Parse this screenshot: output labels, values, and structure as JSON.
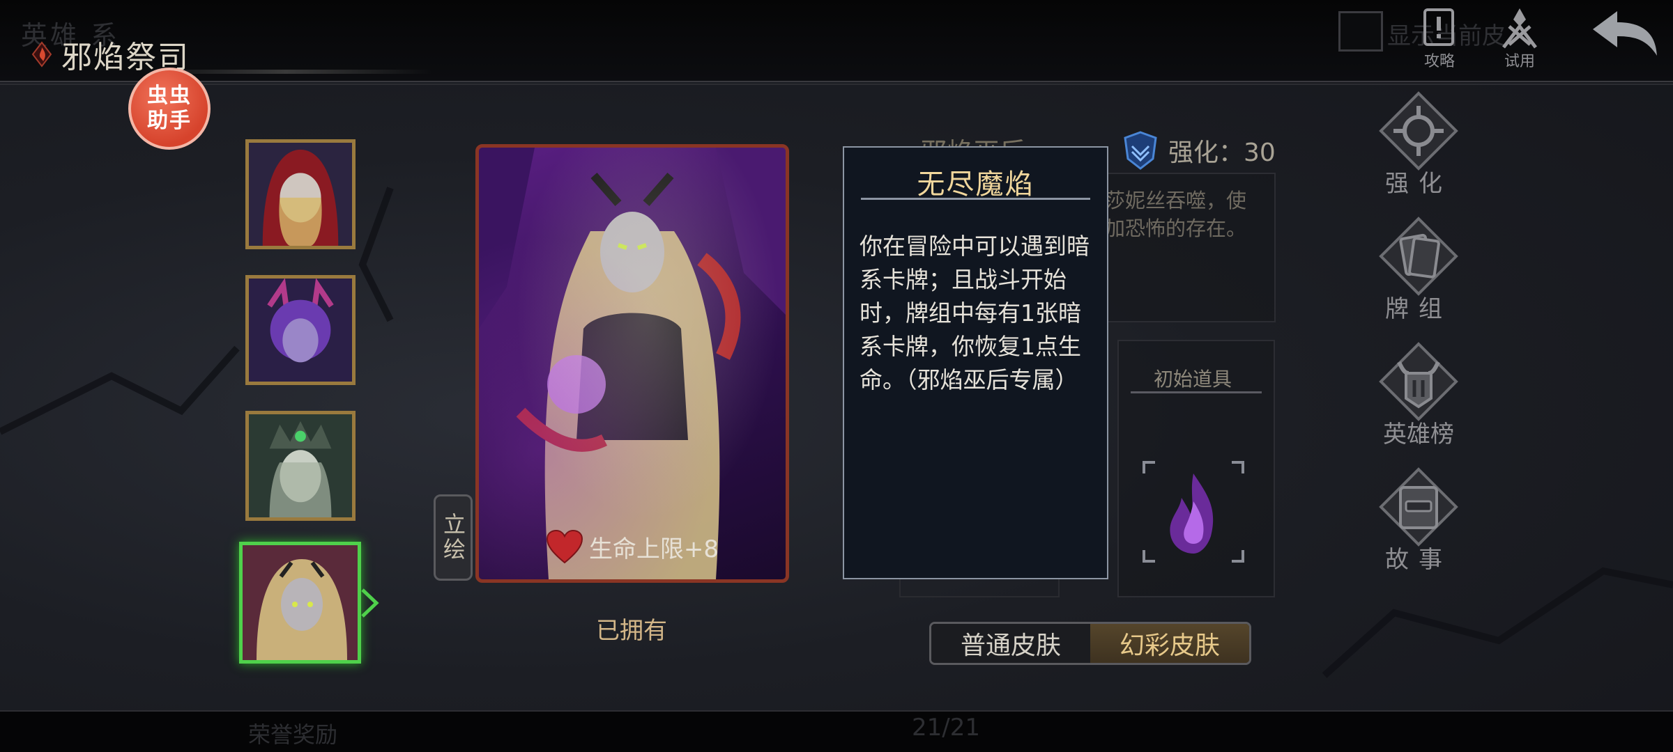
{
  "header": {
    "tabs_ghost": "英雄  系",
    "title": "邪焰祭司",
    "show_checkbox_label": "显示当前皮",
    "strategy_label": "攻略",
    "trial_label": "试用"
  },
  "assistant_badge": "虫虫\n助手",
  "hero_list": [
    {
      "name": "red-hood-hero"
    },
    {
      "name": "purple-horn-hero"
    },
    {
      "name": "green-crown-hero"
    },
    {
      "name": "flame-priestess-hero",
      "selected": true
    }
  ],
  "card": {
    "hp_bonus": "生命上限+8",
    "owned": "已拥有",
    "illustration_button": "立绘"
  },
  "info": {
    "hero_name": "邪焰巫后",
    "enhance": "强化：30",
    "description": "莎妮丝吞噬，使\n加恐怖的存在。",
    "starting_item_label": "初始道具"
  },
  "tooltip": {
    "title": "无尽魔焰",
    "body": "你在冒险中可以遇到暗系卡牌；且战斗开始时，牌组中每有1张暗系卡牌，你恢复1点生命。（邪焰巫后专属）"
  },
  "skin_toggle": {
    "normal": "普通皮肤",
    "illusion": "幻彩皮肤",
    "active": "illusion"
  },
  "right_menu": [
    {
      "label": "强化",
      "icon": "enhance-icon"
    },
    {
      "label": "牌组",
      "icon": "deck-icon"
    },
    {
      "label": "英雄榜",
      "icon": "leaderboard-icon"
    },
    {
      "label": "故事",
      "icon": "story-icon"
    }
  ],
  "footer": {
    "honor_rewards": "荣誉奖励",
    "page_count": "21/21"
  },
  "colors": {
    "accent_gold": "#e7c98a",
    "selected_green": "#4fd14b",
    "badge_red": "#d6432c"
  }
}
